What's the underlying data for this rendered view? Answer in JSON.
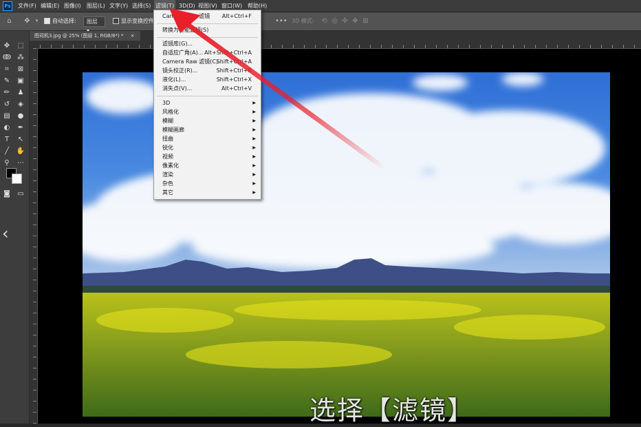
{
  "app": {
    "logo": "Ps"
  },
  "menubar": {
    "items": [
      "文件(F)",
      "编辑(E)",
      "图像(I)",
      "图层(L)",
      "文字(Y)",
      "选择(S)",
      "滤镜(T)",
      "3D(D)",
      "视图(V)",
      "窗口(W)",
      "帮助(H)"
    ]
  },
  "options": {
    "auto_select_label": "自动选择:",
    "auto_select_value": "图层",
    "show_transform_label": "显示变换控件",
    "mode_3d_label": "3D 模式:"
  },
  "document": {
    "tab_title": "图司机3.jpg @ 25% (图层 1, RGB/8*) *",
    "close_glyph": "×"
  },
  "filter_menu": {
    "items": [
      {
        "label": "Camera Raw 滤镜",
        "shortcut": "Alt+Ctrl+F"
      },
      {
        "label": "转换为智能滤镜(S)",
        "shortcut": ""
      },
      {
        "label": "滤镜库(G)...",
        "shortcut": ""
      },
      {
        "label": "自适应广角(A)...",
        "shortcut": "Alt+Shift+Ctrl+A"
      },
      {
        "label": "Camera Raw 滤镜(C)...",
        "shortcut": "Shift+Ctrl+A"
      },
      {
        "label": "镜头校正(R)...",
        "shortcut": "Shift+Ctrl+R"
      },
      {
        "label": "液化(L)...",
        "shortcut": "Shift+Ctrl+X"
      },
      {
        "label": "消失点(V)...",
        "shortcut": "Alt+Ctrl+V"
      }
    ],
    "submenus": [
      "3D",
      "风格化",
      "模糊",
      "模糊画廊",
      "扭曲",
      "锐化",
      "视频",
      "像素化",
      "渲染",
      "杂色",
      "其它"
    ]
  },
  "caption": "选择【滤镜】",
  "colors": {
    "accent": "#e8202a",
    "foreground_swatch": "#000000",
    "background_swatch": "#ffffff"
  }
}
